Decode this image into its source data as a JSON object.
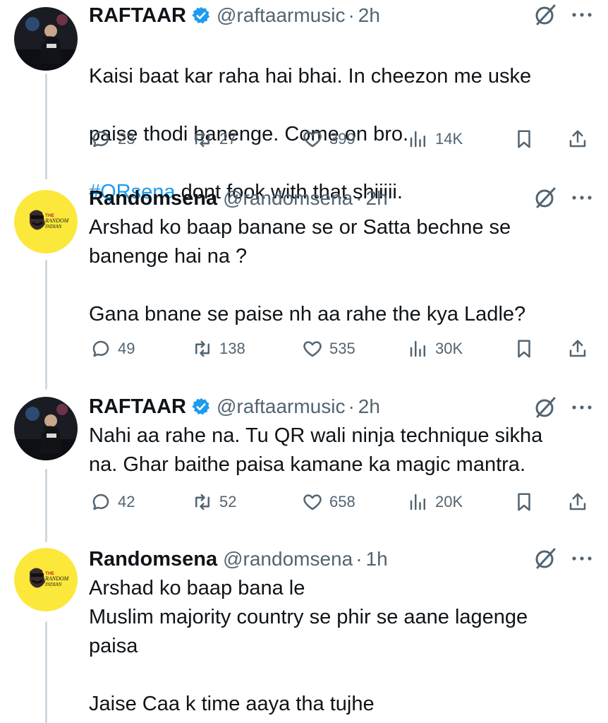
{
  "colors": {
    "text": "#0f1419",
    "secondary": "#536471",
    "link": "#1d9bf0",
    "verified": "#1d9bf0",
    "thread_line": "#cfd9de",
    "randomsena_avatar_bg": "#fbe83a"
  },
  "tweets": [
    {
      "author": "RAFTAAR",
      "verified": true,
      "handle": "@raftaarmusic",
      "dot": "·",
      "time": "2h",
      "lines": [
        "Kaisi baat kar raha hai bhai. In cheezon me uske",
        "paise thodi banenge. Come on bro."
      ],
      "hashtag": "#QRsena",
      "after_hashtag": " dont fook with that shiiiii.",
      "replies": "23",
      "retweets": "27",
      "likes": "399",
      "views": "14K"
    },
    {
      "author": "Randomsena",
      "verified": false,
      "handle": "@randomsena",
      "dot": "·",
      "time": "2h",
      "text": "Arshad ko baap banane se or Satta bechne se\nbanenge hai na ?\n\nGana bnane se paise nh aa rahe the kya Ladle?",
      "replies": "49",
      "retweets": "138",
      "likes": "535",
      "views": "30K"
    },
    {
      "author": "RAFTAAR",
      "verified": true,
      "handle": "@raftaarmusic",
      "dot": "·",
      "time": "2h",
      "text": "Nahi aa rahe na. Tu QR wali ninja technique sikha\nna. Ghar baithe paisa kamane ka magic mantra.",
      "replies": "42",
      "retweets": "52",
      "likes": "658",
      "views": "20K"
    },
    {
      "author": "Randomsena",
      "verified": false,
      "handle": "@randomsena",
      "dot": "·",
      "time": "1h",
      "text": "Arshad ko baap bana le\nMuslim majority country se phir se aane lagenge\npaisa\n\nJaise Caa k time aaya tha tujhe"
    }
  ],
  "avatar_logo": {
    "line1": "THE",
    "line2": "RANDOM",
    "line3": "INDIAN"
  },
  "icons": {
    "reply": "reply-icon",
    "retweet": "retweet-icon",
    "like": "heart-icon",
    "views": "views-icon",
    "bookmark": "bookmark-icon",
    "share": "share-icon",
    "grok": "grok-icon",
    "more": "more-icon",
    "verified": "verified-badge-icon"
  }
}
